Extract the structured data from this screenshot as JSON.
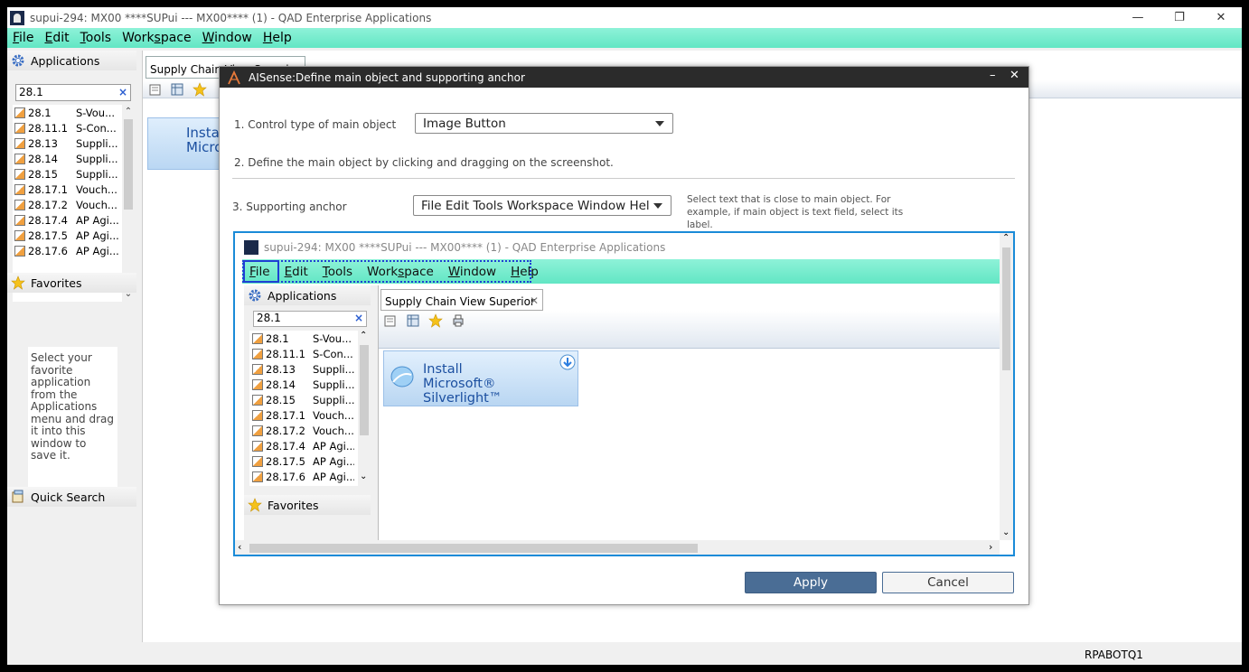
{
  "window": {
    "title": "supui-294: MX00 ****SUPui --- MX00**** (1) - QAD Enterprise Applications",
    "minimize": "—",
    "maximize": "❐",
    "close": "✕"
  },
  "menu": [
    {
      "label": "File",
      "ul": "F",
      "rest": "ile"
    },
    {
      "label": "Edit",
      "ul": "E",
      "rest": "dit"
    },
    {
      "label": "Tools",
      "ul": "T",
      "rest": "ools"
    },
    {
      "label": "Workspace",
      "pre": "Work",
      "ul": "s",
      "rest": "pace"
    },
    {
      "label": "Window",
      "ul": "W",
      "rest": "indow"
    },
    {
      "label": "Help",
      "ul": "H",
      "rest": "elp"
    }
  ],
  "left": {
    "applications_label": "Applications",
    "search_value": "28.1",
    "clear_glyph": "×",
    "apps": [
      {
        "code": "28.1",
        "desc": "S-Vou..."
      },
      {
        "code": "28.11.1",
        "desc": "S-Con..."
      },
      {
        "code": "28.13",
        "desc": "Suppli..."
      },
      {
        "code": "28.14",
        "desc": "Suppli..."
      },
      {
        "code": "28.15",
        "desc": "Suppli..."
      },
      {
        "code": "28.17.1",
        "desc": "Vouch..."
      },
      {
        "code": "28.17.2",
        "desc": "Vouch..."
      },
      {
        "code": "28.17.4",
        "desc": "AP Agi..."
      },
      {
        "code": "28.17.5",
        "desc": "AP Agi..."
      },
      {
        "code": "28.17.6",
        "desc": "AP Agi..."
      }
    ],
    "favorites_label": "Favorites",
    "favorites_hint": "Select your favorite application from the Applications menu and drag it into this window to save it.",
    "quick_search_label": "Quick Search"
  },
  "main": {
    "tab_label": "Supply Chain View Superior",
    "silverlight_line1": "Instal",
    "silverlight_line2": "Micro"
  },
  "status": {
    "user": "RPABOTQ1"
  },
  "dialog": {
    "title": "AISense:Define main object and supporting anchor",
    "minimize": "–",
    "close": "✕",
    "step1_label": "1. Control type of main object",
    "control_type": "Image Button",
    "step2_label": "2. Define the main object by clicking and dragging on the screenshot.",
    "step3_label": "3. Supporting anchor",
    "anchor_value": "File Edit Tools Workspace Window Hel",
    "hint": "Select text that is close to main object. For example, if main object is text field, select its label.",
    "apply": "Apply",
    "cancel": "Cancel"
  },
  "preview": {
    "title": "supui-294: MX00 ****SUPui --- MX00**** (1) - QAD Enterprise Applications",
    "applications_label": "Applications",
    "search_value": "28.1",
    "favorites_label": "Favorites",
    "tab_label": "Supply Chain View Superior",
    "tab_close": "✕",
    "silverlight_line1": "Install",
    "silverlight_line2": "Microsoft® Silverlight™"
  },
  "colors": {
    "menubar": "#62e6c4",
    "dialog_title": "#2b2b2b",
    "apply_button": "#4a6d95",
    "selection": "#1f3fd4",
    "preview_border": "#1a8bd8"
  }
}
